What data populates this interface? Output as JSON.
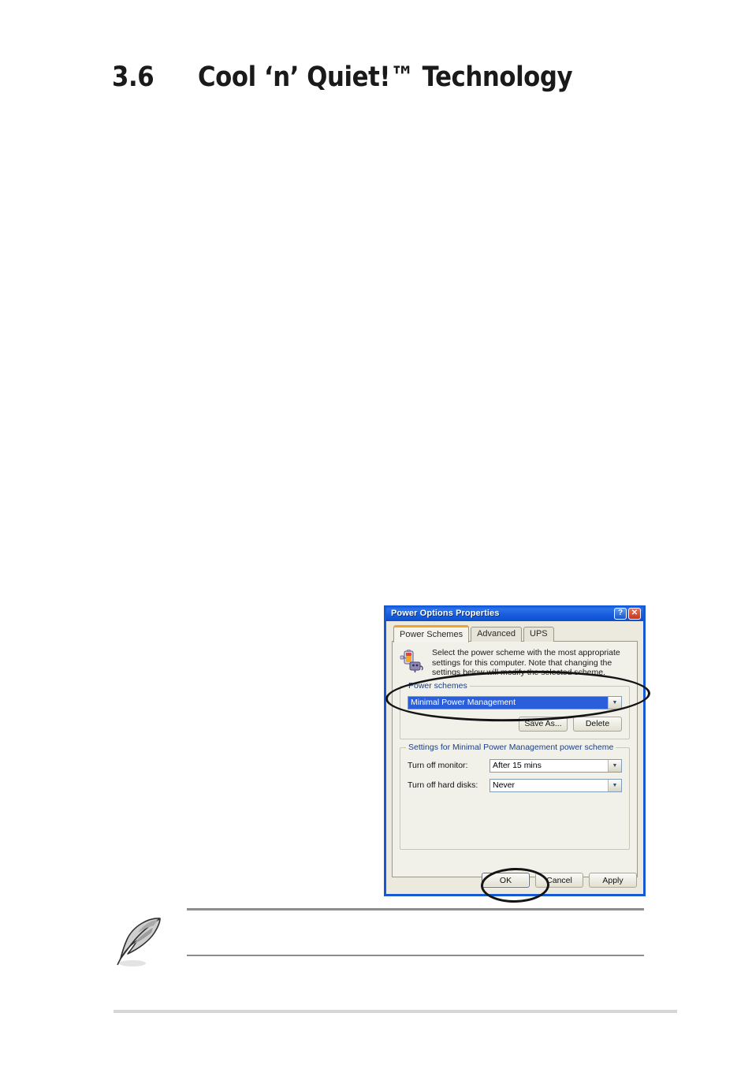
{
  "page": {
    "section_number": "3.6",
    "section_title": "Cool ‘n’ Quiet!™ Technology"
  },
  "dialog": {
    "title": "Power Options Properties",
    "titlebar_buttons": {
      "help": "?",
      "close": "✕"
    },
    "tabs": [
      {
        "label": "Power Schemes",
        "active": true
      },
      {
        "label": "Advanced",
        "active": false
      },
      {
        "label": "UPS",
        "active": false
      }
    ],
    "description": "Select the power scheme with the most appropriate settings for this computer. Note that changing the settings below will modify the selected scheme.",
    "power_schemes_group": {
      "title": "Power schemes",
      "selected_scheme": "Minimal Power Management",
      "dropdown_arrow": "▼",
      "save_as_label": "Save As...",
      "delete_label": "Delete"
    },
    "settings_group": {
      "title": "Settings for Minimal Power Management power scheme",
      "rows": [
        {
          "label": "Turn off monitor:",
          "value": "After 15 mins"
        },
        {
          "label": "Turn off hard disks:",
          "value": "Never"
        }
      ],
      "dropdown_arrow": "▼"
    },
    "actions": {
      "ok_label": "OK",
      "cancel_label": "Cancel",
      "apply_label": "Apply"
    },
    "colors": {
      "titlebar_blue": "#1759d2",
      "selection_blue": "#2b5fd9",
      "group_title_blue": "#1b3f86",
      "active_tab_orange": "#f0a32a",
      "dialog_face": "#eceadf",
      "close_red": "#c2381d"
    }
  },
  "annotations": {
    "scheme_ellipse_name": "highlight-ellipse-power-scheme",
    "ok_ellipse_name": "highlight-ellipse-ok-button"
  },
  "note": {
    "icon": "feather-pen-icon",
    "text": ""
  }
}
